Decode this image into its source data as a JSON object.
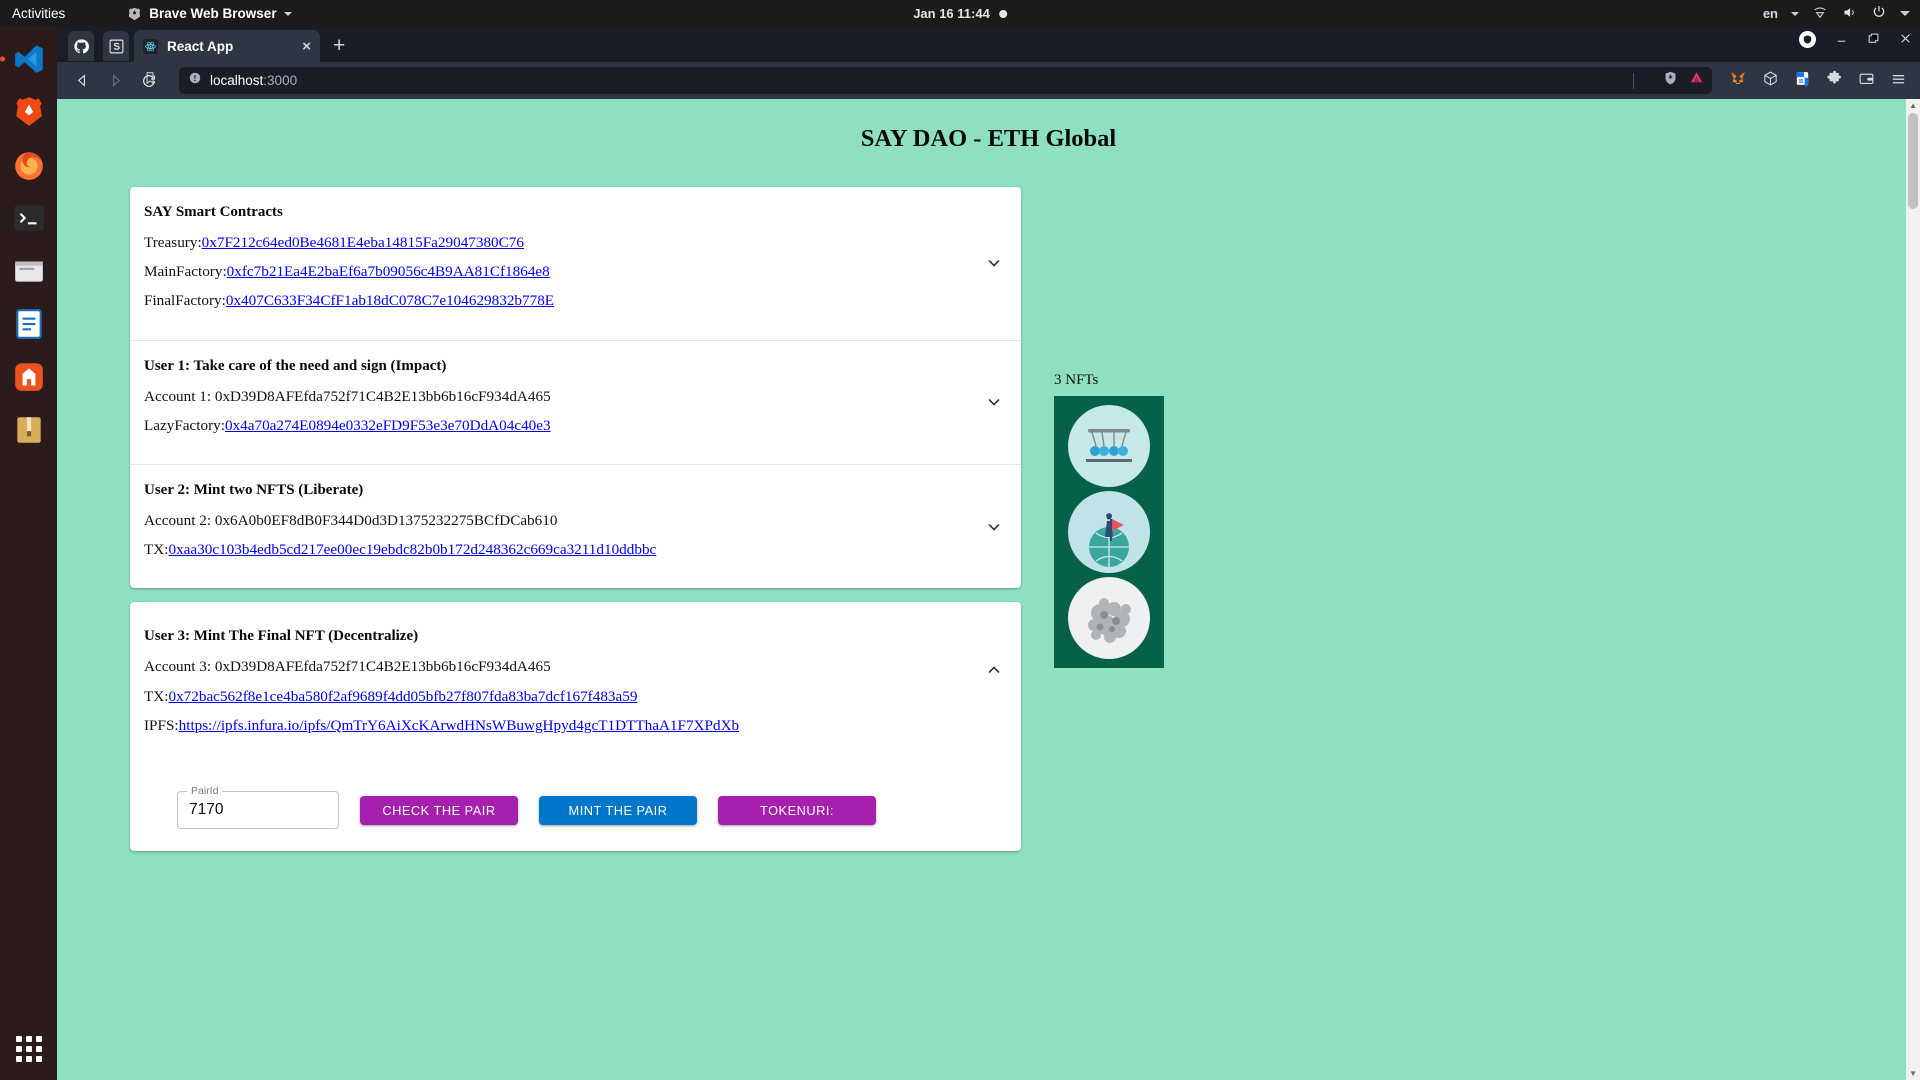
{
  "desktop": {
    "activities_label": "Activities",
    "app_menu_label": "Brave Web Browser",
    "clock": "Jan 16  11:44",
    "language": "en",
    "dock_items": [
      {
        "name": "vscode",
        "label": "Visual Studio Code"
      },
      {
        "name": "brave",
        "label": "Brave Web Browser"
      },
      {
        "name": "firefox",
        "label": "Firefox"
      },
      {
        "name": "terminal",
        "label": "Terminal"
      },
      {
        "name": "files",
        "label": "Files"
      },
      {
        "name": "libreoffice-writer",
        "label": "LibreOffice Writer"
      },
      {
        "name": "ubuntu-software",
        "label": "Ubuntu Software"
      },
      {
        "name": "archive-manager",
        "label": "Archive Manager"
      }
    ],
    "show_apps_label": "Show Applications"
  },
  "browser": {
    "pinned_tabs": [
      {
        "name": "github",
        "label": "GitHub"
      },
      {
        "name": "sketch",
        "label": "S"
      }
    ],
    "active_tab": {
      "title": "React App",
      "close_label": "×"
    },
    "new_tab_label": "+",
    "window_controls": {
      "minimize": "–",
      "maximize": "❐",
      "close": "✕"
    },
    "nav": {
      "back": "◁",
      "forward": "▷",
      "reload": "↻",
      "bookmark": "☆"
    },
    "address": {
      "host": "localhost",
      "port": ":3000",
      "full": "localhost:3000"
    },
    "extensions": [
      {
        "name": "metamask-extension",
        "label": "MetaMask"
      },
      {
        "name": "cube-extension",
        "label": "Block Explorer"
      },
      {
        "name": "google-docs-extension",
        "label": "Google Docs"
      },
      {
        "name": "puzzle-extensions",
        "label": "Extensions"
      },
      {
        "name": "wallet-extension",
        "label": "Wallet"
      },
      {
        "name": "browser-menu",
        "label": "Customize and control Brave"
      }
    ]
  },
  "page": {
    "title": "SAY DAO - ETH Global",
    "background_color": "#8ee0c0",
    "sections": [
      {
        "heading": "SAY Smart Contracts",
        "expanded": false,
        "lines": [
          {
            "label": "Treasury:",
            "link": "0x7F212c64ed0Be4681E4eba14815Fa29047380C76"
          },
          {
            "label": "MainFactory:",
            "link": "0xfc7b21Ea4E2baEf6a7b09056c4B9AA81Cf1864e8"
          },
          {
            "label": "FinalFactory:",
            "link": "0x407C633F34CfF1ab18dC078C7e104629832b778E"
          }
        ]
      },
      {
        "heading": "User 1: Take care of the need and sign (Impact)",
        "expanded": false,
        "lines": [
          {
            "label": "Account 1: 0xD39D8AFEfda752f71C4B2E13bb6b16cF934dA465",
            "link": ""
          },
          {
            "label": "LazyFactory:",
            "link": "0x4a70a274E0894e0332eFD9F53e3e70DdA04c40e3"
          }
        ]
      },
      {
        "heading": "User 2: Mint two NFTS (Liberate)",
        "expanded": false,
        "lines": [
          {
            "label": "Account 2: 0x6A0b0EF8dB0F344D0d3D1375232275BCfDCab610",
            "link": ""
          },
          {
            "label": "TX:",
            "link": "0xaa30c103b4edb5cd217ee00ec19ebdc82b0b172d248362c669ca3211d10ddbbc"
          }
        ]
      }
    ],
    "final_section": {
      "heading": "User 3: Mint The Final NFT (Decentralize)",
      "expanded": true,
      "lines": [
        {
          "label": "Account 3: 0xD39D8AFEfda752f71C4B2E13bb6b16cF934dA465",
          "link": ""
        },
        {
          "label": "TX:",
          "link": "0x72bac562f8e1ce4ba580f2af9689f4dd05bfb27f807fda83ba7dcf167f483a59"
        },
        {
          "label": "IPFS:",
          "link": "https://ipfs.infura.io/ipfs/QmTrY6AiXcKArwdHNsWBuwgHpyd4gcT1DTThaA1F7XPdXb"
        }
      ],
      "form": {
        "field_label": "PairId",
        "field_value": "7170",
        "buttons": [
          {
            "label": "CHECK THE PAIR",
            "color": "#a61fae",
            "name": "check-the-pair-button"
          },
          {
            "label": "MINT THE PAIR",
            "color": "#0177cb",
            "name": "mint-the-pair-button"
          },
          {
            "label": "TOKENURI:",
            "color": "#a61fae",
            "name": "tokenuri-button"
          }
        ]
      }
    },
    "nft_panel": {
      "count_label": "3 NFTs",
      "panel_color": "#066149",
      "items": [
        {
          "name": "nft-newtons-cradle",
          "alt": "Newton's cradle illustration"
        },
        {
          "name": "nft-person-globe",
          "alt": "Person with flag on globe illustration"
        },
        {
          "name": "nft-abstract-cloud",
          "alt": "Abstract grayscale cloud illustration"
        }
      ]
    }
  }
}
